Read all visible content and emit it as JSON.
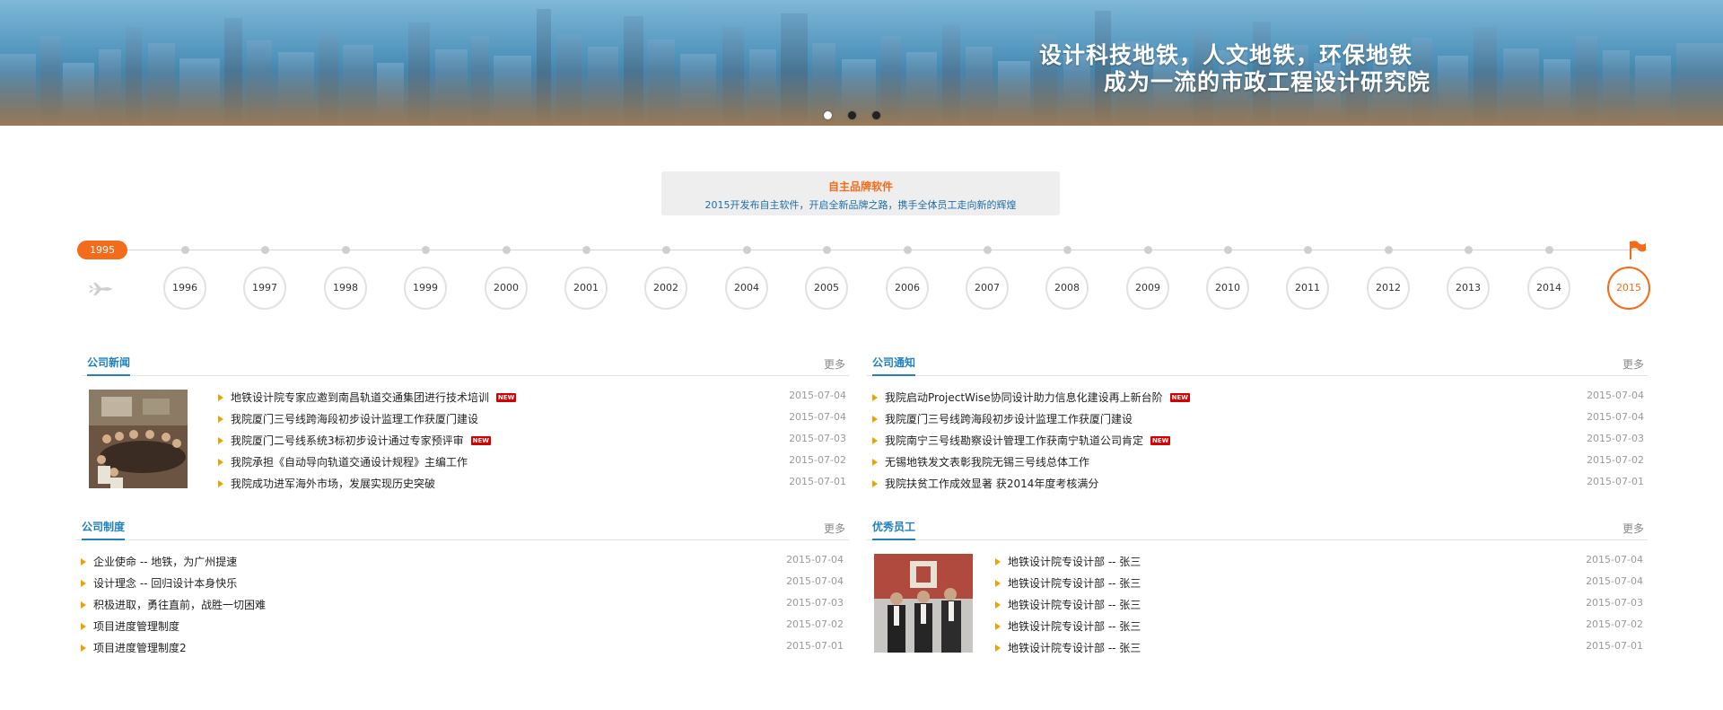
{
  "banner": {
    "line1": "设计科技地铁，人文地铁，环保地铁",
    "line2": "成为一流的市政工程设计研究院"
  },
  "feature": {
    "title": "自主品牌软件",
    "subtitle": "2015开发布自主软件，开启全新品牌之路，携手全体员工走向新的辉煌"
  },
  "timeline": {
    "start": "1995",
    "years": [
      "1996",
      "1997",
      "1998",
      "1999",
      "2000",
      "2001",
      "2002",
      "2004",
      "2005",
      "2006",
      "2007",
      "2008",
      "2009",
      "2010",
      "2011",
      "2012",
      "2013",
      "2014",
      "2015"
    ],
    "active": "2015"
  },
  "news": {
    "title": "公司新闻",
    "more": "更多",
    "items": [
      {
        "text": "地铁设计院专家应邀到南昌轨道交通集团进行技术培训",
        "date": "2015-07-04",
        "new": true
      },
      {
        "text": "我院厦门三号线跨海段初步设计监理工作获厦门建设",
        "date": "2015-07-04",
        "new": false
      },
      {
        "text": "我院厦门二号线系统3标初步设计通过专家预评审",
        "date": "2015-07-03",
        "new": true
      },
      {
        "text": "我院承担《自动导向轨道交通设计规程》主编工作",
        "date": "2015-07-02",
        "new": false
      },
      {
        "text": "我院成功进军海外市场，发展实现历史突破",
        "date": "2015-07-01",
        "new": false
      }
    ]
  },
  "notice": {
    "title": "公司通知",
    "more": "更多",
    "items": [
      {
        "text": "我院启动ProjectWise协同设计助力信息化建设再上新台阶",
        "date": "2015-07-04",
        "new": true
      },
      {
        "text": "我院厦门三号线跨海段初步设计监理工作获厦门建设",
        "date": "2015-07-04",
        "new": false
      },
      {
        "text": "我院南宁三号线勘察设计管理工作获南宁轨道公司肯定",
        "date": "2015-07-03",
        "new": true
      },
      {
        "text": "无锡地铁发文表彰我院无锡三号线总体工作",
        "date": "2015-07-02",
        "new": false
      },
      {
        "text": "我院扶贫工作成效显著 获2014年度考核满分",
        "date": "2015-07-01",
        "new": false
      }
    ]
  },
  "rules": {
    "title": "公司制度",
    "more": "更多",
    "items": [
      {
        "text": "企业使命  --  地铁，为广州提速",
        "date": "2015-07-04"
      },
      {
        "text": "设计理念  --  回归设计本身快乐",
        "date": "2015-07-04"
      },
      {
        "text": "积极进取，勇往直前，战胜一切困难",
        "date": "2015-07-03"
      },
      {
        "text": "项目进度管理制度",
        "date": "2015-07-02"
      },
      {
        "text": "项目进度管理制度2",
        "date": "2015-07-01"
      }
    ]
  },
  "staff": {
    "title": "优秀员工",
    "more": "更多",
    "items": [
      {
        "text": "地铁设计院专设计部  --  张三",
        "date": "2015-07-04"
      },
      {
        "text": "地铁设计院专设计部  --  张三",
        "date": "2015-07-04"
      },
      {
        "text": "地铁设计院专设计部  --  张三",
        "date": "2015-07-03"
      },
      {
        "text": "地铁设计院专设计部  --  张三",
        "date": "2015-07-02"
      },
      {
        "text": "地铁设计院专设计部  --  张三",
        "date": "2015-07-01"
      }
    ]
  },
  "new_badge": "NEW"
}
